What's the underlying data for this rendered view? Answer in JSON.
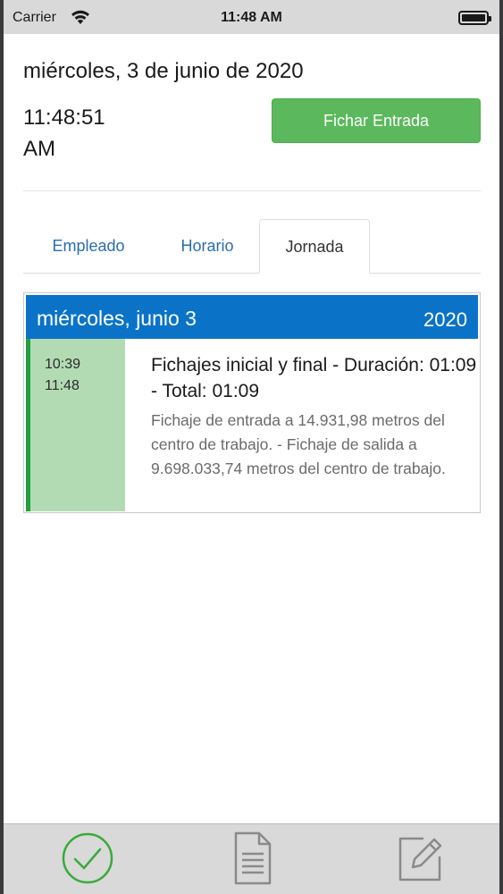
{
  "status_bar": {
    "carrier": "Carrier",
    "time": "11:48 AM"
  },
  "header": {
    "date": "miércoles, 3 de junio de 2020",
    "time_line1": "11:48:51",
    "time_line2": "AM",
    "punch_button": "Fichar Entrada"
  },
  "tabs": [
    {
      "label": "Empleado",
      "active": false
    },
    {
      "label": "Horario",
      "active": false
    },
    {
      "label": "Jornada",
      "active": true
    }
  ],
  "day": {
    "date": "miércoles, junio 3",
    "year": "2020",
    "entry": {
      "time_in": "10:39",
      "time_out": "11:48",
      "title": "Fichajes inicial y final - Duración: 01:09 - Total: 01:09",
      "detail": "Fichaje de entrada a 14.931,98 metros del centro de trabajo. - Fichaje de salida a 9.698.033,74 metros del centro de trabajo."
    }
  },
  "bottom_bar": {
    "items": [
      {
        "icon": "check-circle-icon",
        "color": "#3aaa3a"
      },
      {
        "icon": "document-icon",
        "color": "#8a8a8a"
      },
      {
        "icon": "edit-icon",
        "color": "#8a8a8a"
      }
    ]
  },
  "colors": {
    "accent_blue": "#0a73c8",
    "button_green": "#5cb85c",
    "time_bg": "#b3dbb3",
    "time_bar": "#20a040"
  }
}
